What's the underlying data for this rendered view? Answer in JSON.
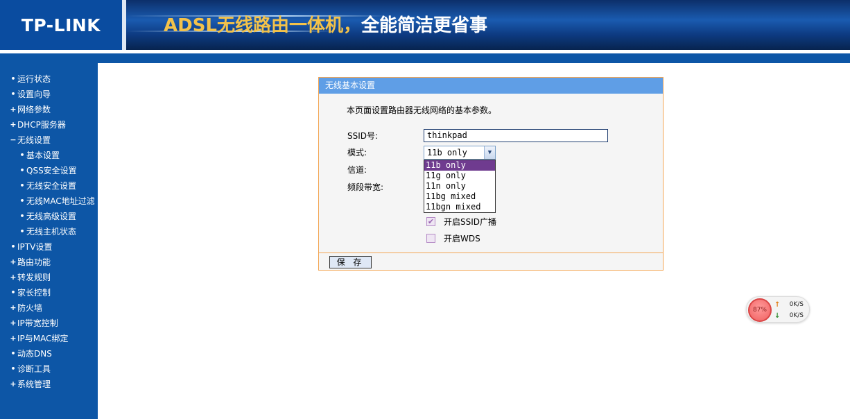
{
  "header": {
    "logo": "TP-LINK",
    "slogan_part1": "ADSL无线路由一体机，",
    "slogan_part2": "全能简洁更省事"
  },
  "sidebar": {
    "items": [
      {
        "mark": "•",
        "label": "运行状态",
        "level": 0
      },
      {
        "mark": "•",
        "label": "设置向导",
        "level": 0
      },
      {
        "mark": "+",
        "label": "网络参数",
        "level": 0
      },
      {
        "mark": "+",
        "label": "DHCP服务器",
        "level": 0
      },
      {
        "mark": "−",
        "label": "无线设置",
        "level": 0
      },
      {
        "mark": "•",
        "label": "基本设置",
        "level": 1
      },
      {
        "mark": "•",
        "label": "QSS安全设置",
        "level": 1
      },
      {
        "mark": "•",
        "label": "无线安全设置",
        "level": 1
      },
      {
        "mark": "•",
        "label": "无线MAC地址过滤",
        "level": 1
      },
      {
        "mark": "•",
        "label": "无线高级设置",
        "level": 1
      },
      {
        "mark": "•",
        "label": "无线主机状态",
        "level": 1
      },
      {
        "mark": "•",
        "label": "IPTV设置",
        "level": 0
      },
      {
        "mark": "+",
        "label": "路由功能",
        "level": 0
      },
      {
        "mark": "+",
        "label": "转发规则",
        "level": 0
      },
      {
        "mark": "•",
        "label": "家长控制",
        "level": 0
      },
      {
        "mark": "+",
        "label": "防火墙",
        "level": 0
      },
      {
        "mark": "+",
        "label": "IP带宽控制",
        "level": 0
      },
      {
        "mark": "+",
        "label": "IP与MAC绑定",
        "level": 0
      },
      {
        "mark": "•",
        "label": "动态DNS",
        "level": 0
      },
      {
        "mark": "•",
        "label": "诊断工具",
        "level": 0
      },
      {
        "mark": "+",
        "label": "系统管理",
        "level": 0
      }
    ]
  },
  "panel": {
    "title": "无线基本设置",
    "description": "本页面设置路由器无线网络的基本参数。",
    "ssid_label": "SSID号:",
    "ssid_value": "thinkpad",
    "mode_label": "模式:",
    "mode_value": "11b only",
    "mode_options": [
      "11b only",
      "11g only",
      "11n only",
      "11bg mixed",
      "11bgn mixed"
    ],
    "channel_label": "信道:",
    "bandwidth_label": "频段带宽:",
    "ssid_broadcast_label": "开启SSID广播",
    "ssid_broadcast_checked": true,
    "wds_label": "开启WDS",
    "wds_checked": false,
    "save_label": "保 存"
  },
  "speed_widget": {
    "percent": "87%",
    "up_arrow": "↑",
    "up": "0K/S",
    "down_arrow": "↓",
    "down": "0K/S",
    "up_color": "#e07a10",
    "down_color": "#2e8b2e"
  },
  "colors": {
    "nav_bg": "#0d56a6",
    "panel_title_bg": "#5f9ee6",
    "panel_border": "#f3a552",
    "selected_option": "#6f3b8f"
  }
}
